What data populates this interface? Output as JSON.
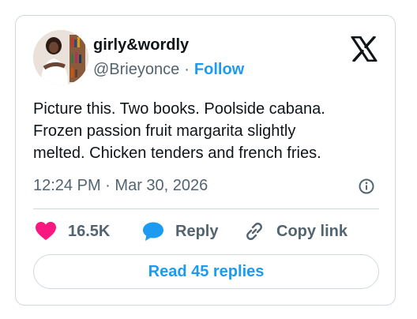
{
  "author": {
    "name": "girly&wordly",
    "handle": "@Brieyonce",
    "separator": "·",
    "follow_label": "Follow"
  },
  "tweet": {
    "lines": [
      "Picture this. Two books. Poolside cabana.",
      "Frozen passion fruit margarita slightly",
      "melted. Chicken tenders and french fries."
    ],
    "time": "12:24 PM",
    "date": "Mar 30, 2026",
    "meta_separator": "·"
  },
  "actions": {
    "likes": "16.5K",
    "reply_label": "Reply",
    "copy_label": "Copy link"
  },
  "read_replies_label": "Read 45 replies",
  "colors": {
    "accent": "#1d9bf0",
    "like": "#f91880",
    "muted": "#536471",
    "border": "#cfd9de"
  },
  "icons": [
    "x-logo-icon",
    "info-icon",
    "heart-icon",
    "reply-bubble-icon",
    "link-icon"
  ]
}
